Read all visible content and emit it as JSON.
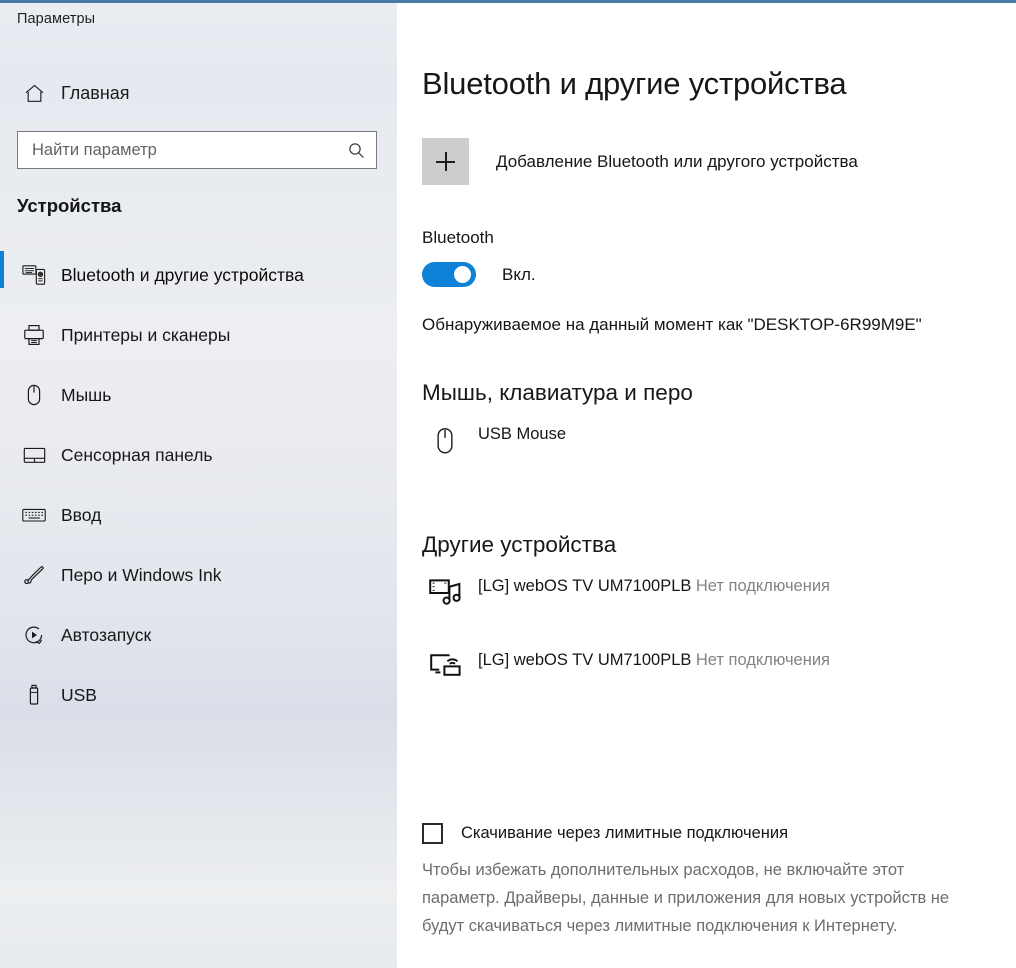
{
  "window": {
    "app_title": "Параметры",
    "accent_color": "#4a7ba7"
  },
  "sidebar": {
    "home": {
      "label": "Главная",
      "icon": "home-icon"
    },
    "search": {
      "value": "",
      "placeholder": "Найти параметр",
      "icon": "search-icon"
    },
    "category_heading": "Устройства",
    "items": [
      {
        "label": "Bluetooth и другие устройства",
        "icon": "bluetooth-devices-icon",
        "selected": true
      },
      {
        "label": "Принтеры и сканеры",
        "icon": "printer-icon",
        "selected": false
      },
      {
        "label": "Мышь",
        "icon": "mouse-icon",
        "selected": false
      },
      {
        "label": "Сенсорная панель",
        "icon": "touchpad-icon",
        "selected": false
      },
      {
        "label": "Ввод",
        "icon": "keyboard-icon",
        "selected": false
      },
      {
        "label": "Перо и Windows Ink",
        "icon": "pen-icon",
        "selected": false
      },
      {
        "label": "Автозапуск",
        "icon": "autoplay-icon",
        "selected": false
      },
      {
        "label": "USB",
        "icon": "usb-icon",
        "selected": false
      }
    ],
    "selection_color": "#0f81d6"
  },
  "main": {
    "page_title": "Bluetooth и другие устройства",
    "add_device": {
      "label": "Добавление Bluetooth или другого устройства",
      "icon": "plus-icon"
    },
    "bluetooth": {
      "label": "Bluetooth",
      "toggle_state": "Вкл.",
      "toggle_on": true,
      "toggle_color": "#0f81d6",
      "discoverable_text": "Обнаруживаемое на данный момент как \"DESKTOP-6R99M9E\""
    },
    "groups": [
      {
        "heading": "Мышь, клавиатура и перо",
        "devices": [
          {
            "name": "USB Mouse",
            "status": "",
            "icon": "mouse-icon"
          }
        ]
      },
      {
        "heading": "Другие устройства",
        "devices": [
          {
            "name": "[LG] webOS TV UM7100PLB",
            "status": "Нет подключения",
            "icon": "media-device-icon"
          },
          {
            "name": "[LG] webOS TV UM7100PLB",
            "status": "Нет подключения",
            "icon": "cast-display-icon"
          }
        ]
      }
    ],
    "metered": {
      "checkbox_label": "Скачивание через лимитные подключения",
      "checked": false,
      "description": "Чтобы избежать дополнительных расходов, не включайте этот параметр. Драйверы, данные и приложения для новых устройств не будут скачиваться через лимитные подключения к Интернету."
    }
  }
}
